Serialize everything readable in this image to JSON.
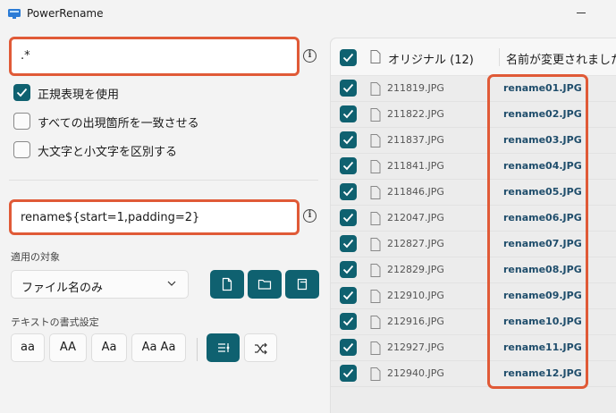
{
  "window": {
    "title": "PowerRename"
  },
  "search": {
    "value": ".*"
  },
  "options": [
    {
      "label": "正規表現を使用",
      "checked": true
    },
    {
      "label": "すべての出現箇所を一致させる",
      "checked": false
    },
    {
      "label": "大文字と小文字を区別する",
      "checked": false
    }
  ],
  "replace": {
    "value": "rename${start=1,padding=2}"
  },
  "apply_to": {
    "label": "適用の対象",
    "selected": "ファイル名のみ",
    "buttons": [
      "file-icon",
      "folder-icon",
      "subfolder-icon"
    ]
  },
  "text_format": {
    "label": "テキストの書式設定",
    "buttons": [
      "aa",
      "AA",
      "Aa",
      "Aa Aa"
    ],
    "extra_buttons": [
      "enumerate-icon",
      "shuffle-icon"
    ]
  },
  "file_list": {
    "header_original": "オリジナル (12)",
    "header_renamed": "名前が変更されました",
    "rows": [
      {
        "original": "211819.JPG",
        "renamed": "rename01.JPG"
      },
      {
        "original": "211822.JPG",
        "renamed": "rename02.JPG"
      },
      {
        "original": "211837.JPG",
        "renamed": "rename03.JPG"
      },
      {
        "original": "211841.JPG",
        "renamed": "rename04.JPG"
      },
      {
        "original": "211846.JPG",
        "renamed": "rename05.JPG"
      },
      {
        "original": "212047.JPG",
        "renamed": "rename06.JPG"
      },
      {
        "original": "212827.JPG",
        "renamed": "rename07.JPG"
      },
      {
        "original": "212829.JPG",
        "renamed": "rename08.JPG"
      },
      {
        "original": "212910.JPG",
        "renamed": "rename09.JPG"
      },
      {
        "original": "212916.JPG",
        "renamed": "rename10.JPG"
      },
      {
        "original": "212927.JPG",
        "renamed": "rename11.JPG"
      },
      {
        "original": "212940.JPG",
        "renamed": "rename12.JPG"
      }
    ]
  },
  "colors": {
    "accent": "#0f6170",
    "highlight": "#e05a37",
    "renamed_text": "#1f4d6b"
  }
}
